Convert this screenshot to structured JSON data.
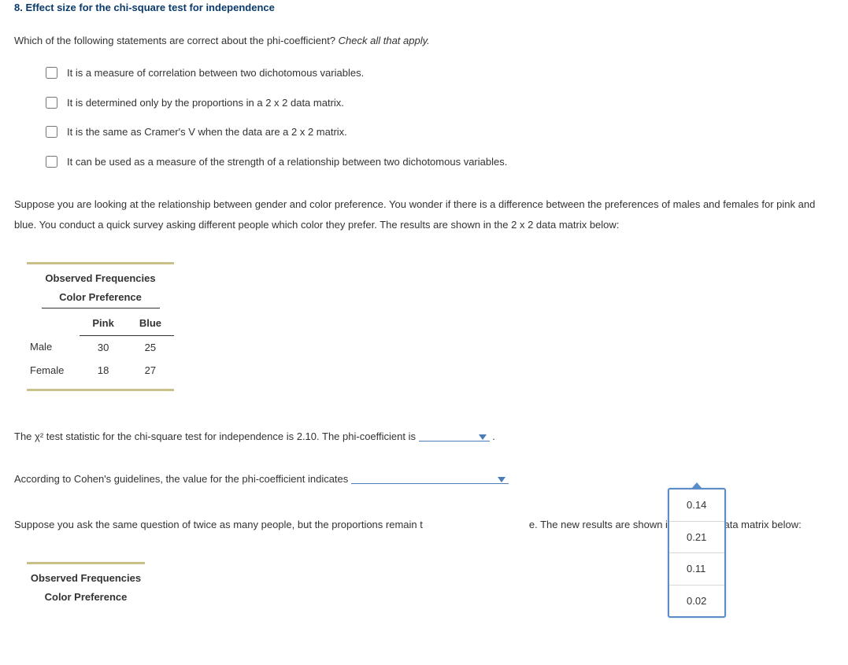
{
  "title": "8. Effect size for the chi-square test for independence",
  "prompt_lead": "Which of the following statements are correct about the phi-coefficient? ",
  "prompt_hint": "Check all that apply.",
  "options": [
    "It is a measure of correlation between two dichotomous variables.",
    "It is determined only by the proportions in a 2 x 2 data matrix.",
    "It is the same as Cramer's V when the data are a 2 x 2 matrix.",
    "It can be used as a measure of the strength of a relationship between two dichotomous variables."
  ],
  "scenario": "Suppose you are looking at the relationship between gender and color preference. You wonder if there is a difference between the preferences of males and females for pink and blue. You conduct a quick survey asking different people which color they prefer. The results are shown in the 2 x 2 data matrix below:",
  "freq1": {
    "title": "Observed Frequencies",
    "subtitle": "Color Preference",
    "cols": [
      "Pink",
      "Blue"
    ],
    "rows": [
      {
        "label": "Male",
        "vals": [
          "30",
          "25"
        ]
      },
      {
        "label": "Female",
        "vals": [
          "18",
          "27"
        ]
      }
    ]
  },
  "q_chisq_a": "The χ² test statistic for the chi-square test for independence is 2.10. The phi-coefficient is ",
  "q_chisq_tail": " .",
  "q_cohen": "According to Cohen's guidelines, the value for the phi-coefficient indicates ",
  "q_twice_a": "Suppose you ask the same question of twice as many people, but the proportions remain t",
  "q_twice_b": "e. The new results are shown in the 2 x 2 data matrix below:",
  "dropdown": [
    "0.14",
    "0.21",
    "0.11",
    "0.02"
  ],
  "freq2": {
    "title": "Observed Frequencies",
    "subtitle": "Color Preference"
  }
}
